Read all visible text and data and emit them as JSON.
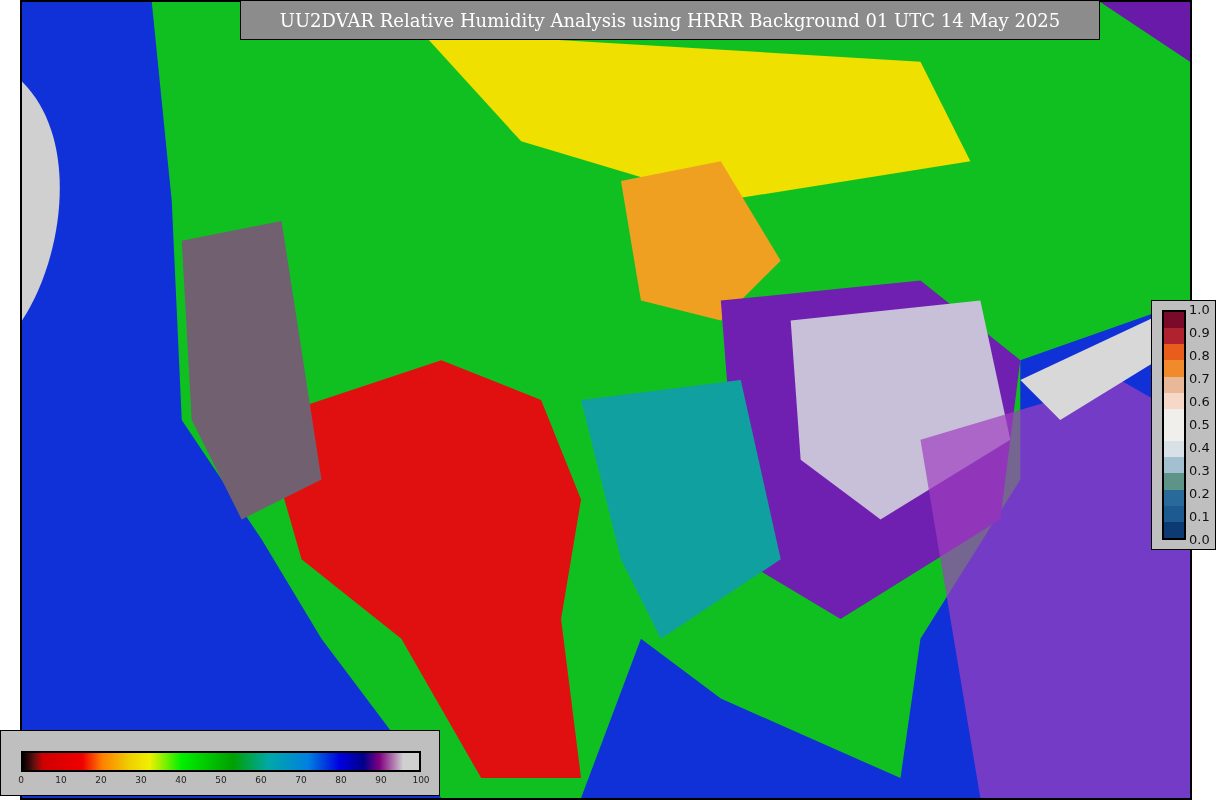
{
  "title": "UU2DVAR Relative Humidity Analysis using HRRR Background 01 UTC 14 May 2025",
  "right_colorbar": {
    "ticks": [
      "1.0",
      "0.9",
      "0.8",
      "0.7",
      "0.6",
      "0.5",
      "0.4",
      "0.3",
      "0.2",
      "0.1",
      "0.0"
    ]
  },
  "bottom_colorbar": {
    "ticks": [
      "0",
      "10",
      "20",
      "30",
      "40",
      "50",
      "60",
      "70",
      "80",
      "90",
      "100"
    ]
  }
}
